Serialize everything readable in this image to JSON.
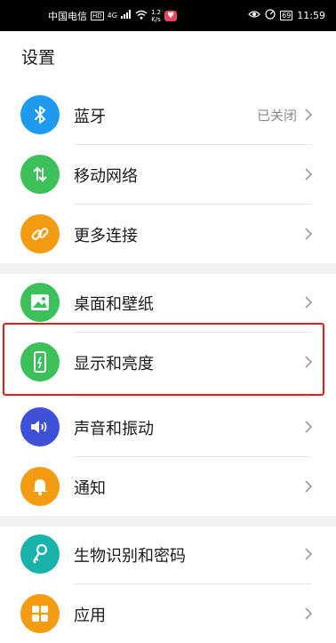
{
  "status_bar": {
    "carrier": "中国电信",
    "network_badge": "HD",
    "signal_type": "4G",
    "speed_top": "1.2",
    "speed_unit": "K/s",
    "battery": "69",
    "time": "11:59"
  },
  "page": {
    "title": "设置"
  },
  "settings": [
    {
      "label": "蓝牙",
      "value": "已关闭",
      "icon": "bluetooth-icon",
      "color": "#1e9bf0"
    },
    {
      "label": "移动网络",
      "value": "",
      "icon": "mobile-data-icon",
      "color": "#3cc05a"
    },
    {
      "label": "更多连接",
      "value": "",
      "icon": "link-icon",
      "color": "#f39c12"
    },
    {
      "label": "桌面和壁纸",
      "value": "",
      "icon": "wallpaper-icon",
      "color": "#3cc05a"
    },
    {
      "label": "显示和亮度",
      "value": "",
      "icon": "display-icon",
      "color": "#3cc05a"
    },
    {
      "label": "声音和振动",
      "value": "",
      "icon": "sound-icon",
      "color": "#3f51d8"
    },
    {
      "label": "通知",
      "value": "",
      "icon": "bell-icon",
      "color": "#f39c12"
    },
    {
      "label": "生物识别和密码",
      "value": "",
      "icon": "key-icon",
      "color": "#17b3a8"
    },
    {
      "label": "应用",
      "value": "",
      "icon": "apps-icon",
      "color": "#f39c12"
    }
  ]
}
